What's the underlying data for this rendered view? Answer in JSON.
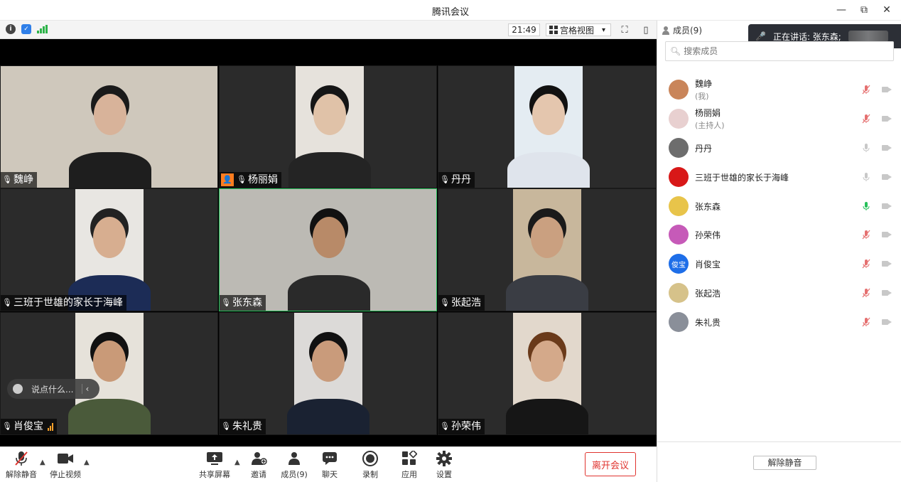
{
  "window": {
    "title": "腾讯会议",
    "minimize": "—",
    "restore": "⧉",
    "close": "✕"
  },
  "toolbar_top": {
    "time": "21:49",
    "view_label": "宫格视图",
    "view_caret": "▾"
  },
  "icons": {
    "info": "info-icon",
    "security": "shield-icon",
    "signal": "signal-icon",
    "fullscreen": "fullscreen-icon",
    "sidebar_toggle": "sidebar-toggle-icon"
  },
  "tiles": [
    {
      "name": "魏峥",
      "host": false,
      "signal": false,
      "active": false
    },
    {
      "name": "杨丽娟",
      "host": true,
      "signal": false,
      "active": false
    },
    {
      "name": "丹丹",
      "host": false,
      "signal": false,
      "active": false
    },
    {
      "name": "三班于世雄的家长于海峰",
      "host": false,
      "signal": false,
      "active": false
    },
    {
      "name": "张东森",
      "host": false,
      "signal": false,
      "active": true
    },
    {
      "name": "张起浩",
      "host": false,
      "signal": false,
      "active": false
    },
    {
      "name": "肖俊宝",
      "host": false,
      "signal": true,
      "active": false
    },
    {
      "name": "朱礼贵",
      "host": false,
      "signal": false,
      "active": false
    },
    {
      "name": "孙荣伟",
      "host": false,
      "signal": false,
      "active": false
    }
  ],
  "chat_input": {
    "placeholder": "说点什么...",
    "collapse": "‹"
  },
  "bottom": {
    "unmute": "解除静音",
    "stop_video": "停止视频",
    "share_screen": "共享屏幕",
    "invite": "邀请",
    "members": "成员(9)",
    "chat": "聊天",
    "record": "录制",
    "apps": "应用",
    "settings": "设置",
    "leave": "离开会议"
  },
  "panel": {
    "header": "成员(9)",
    "speaking": "正在讲话: 张东森;",
    "search_placeholder": "搜索成员",
    "unmute_all": "解除静音",
    "members": [
      {
        "name": "魏峥",
        "role": "(我)",
        "mic": "muted",
        "avatar_color": "#c9855a"
      },
      {
        "name": "杨丽娟",
        "role": "(主持人)",
        "mic": "muted",
        "avatar_color": "#e8d0d0"
      },
      {
        "name": "丹丹",
        "role": "",
        "mic": "off",
        "avatar_color": "#6d6d6d"
      },
      {
        "name": "三班于世雄的家长于海峰",
        "role": "",
        "mic": "off",
        "avatar_color": "#d81818"
      },
      {
        "name": "张东森",
        "role": "",
        "mic": "speaking",
        "avatar_color": "#e8c44a"
      },
      {
        "name": "孙荣伟",
        "role": "",
        "mic": "muted",
        "avatar_color": "#c65ab8"
      },
      {
        "name": "肖俊宝",
        "role": "",
        "mic": "muted",
        "avatar_color": "#1e6ee8",
        "avatar_text": "俊宝"
      },
      {
        "name": "张起浩",
        "role": "",
        "mic": "muted",
        "avatar_color": "#d6c28a"
      },
      {
        "name": "朱礼贵",
        "role": "",
        "mic": "muted",
        "avatar_color": "#8a8f99"
      }
    ]
  },
  "colors": {
    "accent_red": "#e0342f",
    "speaking_green": "#26c05a",
    "host_orange": "#ff7d1f"
  }
}
